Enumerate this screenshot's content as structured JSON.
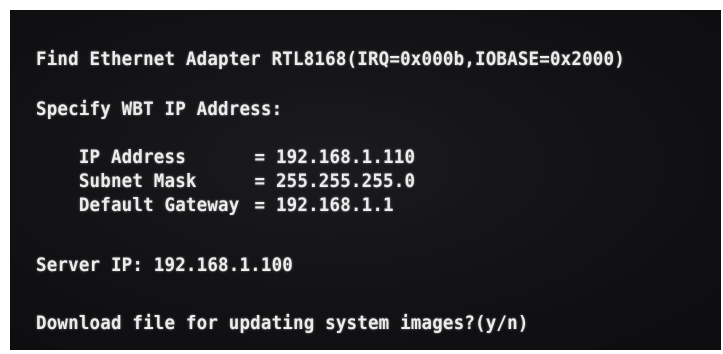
{
  "console": {
    "adapter_line": "Find Ethernet Adapter RTL8168(IRQ=0x000b,IOBASE=0x2000)",
    "specify_heading": "Specify WBT IP Address:",
    "fields": [
      {
        "label": "IP Address",
        "value": "= 192.168.1.110"
      },
      {
        "label": "Subnet Mask",
        "value": "= 255.255.255.0"
      },
      {
        "label": "Default Gateway",
        "value": "= 192.168.1.1"
      }
    ],
    "server_ip": "Server IP: 192.168.1.100",
    "download_prompt": "Download file for updating system images?(y/n)"
  }
}
